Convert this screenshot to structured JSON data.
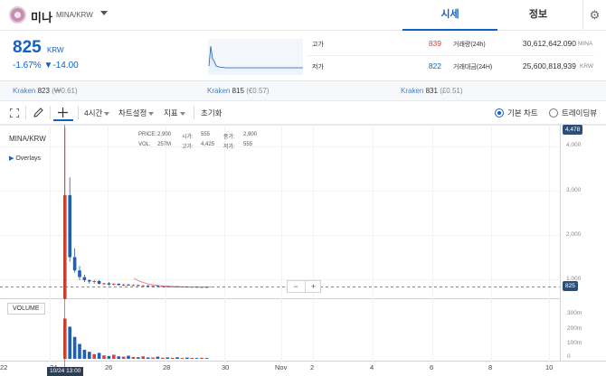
{
  "header": {
    "coin_name": "미나",
    "pair": "MINA/KRW",
    "tabs": [
      "시세",
      "정보"
    ]
  },
  "price": {
    "current": "825",
    "unit": "KRW",
    "change": "-1.67% ▼-14.00",
    "high_label": "고가",
    "high": "839",
    "low_label": "저가",
    "low": "822",
    "volume_label": "거래량(24h)",
    "volume": "30,612,642.090",
    "volume_unit": "MINA",
    "amount_label": "거래대금(24H)",
    "amount": "25,600,818,939",
    "amount_unit": "KRW"
  },
  "exchanges": [
    {
      "name": "Kraken",
      "price": "823",
      "diff": "(₩0.61)"
    },
    {
      "name": "Kraken",
      "price": "815",
      "diff": "(€0.57)"
    },
    {
      "name": "Kraken",
      "price": "831",
      "diff": "(£0.51)"
    }
  ],
  "toolbar": {
    "interval": "4시간",
    "chart_settings": "차트설정",
    "indicators": "지표",
    "reset": "초기화",
    "basic_chart": "기본 차트",
    "tradingview": "트레이딩뷰"
  },
  "chart": {
    "pair": "MINA/KRW",
    "overlays": "Overlays",
    "ohlc": {
      "price_label": "PRICE:",
      "price": "2,900",
      "open_label": "시가:",
      "open": "555",
      "close_label": "종가:",
      "close": "2,900",
      "vol_label": "VOL:",
      "vol": "257M",
      "high_label": "고가:",
      "high": "4,425",
      "low_label": "저가:",
      "low": "555"
    },
    "volume_label": "VOLUME",
    "last_price_tag": "825",
    "top_tag": "4,478",
    "cursor_time": "10/24 13:00",
    "zoom_out": "−",
    "zoom_in": "+"
  },
  "chart_data": {
    "type": "candlestick",
    "y_ticks": [
      "4,000",
      "3,000",
      "2,000",
      "1,000"
    ],
    "volume_ticks": [
      "300m",
      "200m",
      "100m",
      "0"
    ],
    "x_ticks": [
      "22",
      "24",
      "26",
      "28",
      "30",
      "Nov",
      "2",
      "4",
      "6",
      "8",
      "10"
    ],
    "candles": [
      {
        "o": 555,
        "h": 4425,
        "l": 555,
        "c": 2900,
        "dir": "up"
      },
      {
        "o": 2900,
        "h": 3300,
        "l": 1400,
        "c": 1500,
        "dir": "down"
      },
      {
        "o": 1500,
        "h": 1700,
        "l": 1150,
        "c": 1200,
        "dir": "down"
      },
      {
        "o": 1200,
        "h": 1300,
        "l": 980,
        "c": 1050,
        "dir": "down"
      },
      {
        "o": 1050,
        "h": 1100,
        "l": 940,
        "c": 980,
        "dir": "down"
      },
      {
        "o": 980,
        "h": 1000,
        "l": 900,
        "c": 950,
        "dir": "down"
      },
      {
        "o": 950,
        "h": 990,
        "l": 900,
        "c": 960,
        "dir": "up"
      },
      {
        "o": 960,
        "h": 980,
        "l": 880,
        "c": 900,
        "dir": "down"
      },
      {
        "o": 900,
        "h": 920,
        "l": 870,
        "c": 910,
        "dir": "up"
      },
      {
        "o": 910,
        "h": 940,
        "l": 860,
        "c": 880,
        "dir": "down"
      },
      {
        "o": 880,
        "h": 910,
        "l": 860,
        "c": 900,
        "dir": "up"
      },
      {
        "o": 900,
        "h": 910,
        "l": 860,
        "c": 870,
        "dir": "down"
      },
      {
        "o": 870,
        "h": 900,
        "l": 850,
        "c": 880,
        "dir": "up"
      },
      {
        "o": 880,
        "h": 900,
        "l": 860,
        "c": 865,
        "dir": "down"
      },
      {
        "o": 865,
        "h": 890,
        "l": 850,
        "c": 870,
        "dir": "up"
      },
      {
        "o": 870,
        "h": 880,
        "l": 845,
        "c": 855,
        "dir": "down"
      },
      {
        "o": 855,
        "h": 870,
        "l": 845,
        "c": 860,
        "dir": "up"
      },
      {
        "o": 860,
        "h": 870,
        "l": 840,
        "c": 848,
        "dir": "down"
      },
      {
        "o": 848,
        "h": 860,
        "l": 838,
        "c": 852,
        "dir": "up"
      },
      {
        "o": 852,
        "h": 858,
        "l": 835,
        "c": 842,
        "dir": "down"
      },
      {
        "o": 842,
        "h": 850,
        "l": 832,
        "c": 845,
        "dir": "up"
      },
      {
        "o": 845,
        "h": 850,
        "l": 830,
        "c": 838,
        "dir": "down"
      },
      {
        "o": 838,
        "h": 845,
        "l": 828,
        "c": 841,
        "dir": "up"
      },
      {
        "o": 841,
        "h": 845,
        "l": 828,
        "c": 833,
        "dir": "down"
      },
      {
        "o": 833,
        "h": 842,
        "l": 826,
        "c": 836,
        "dir": "up"
      },
      {
        "o": 836,
        "h": 840,
        "l": 824,
        "c": 829,
        "dir": "down"
      },
      {
        "o": 829,
        "h": 836,
        "l": 823,
        "c": 832,
        "dir": "up"
      },
      {
        "o": 832,
        "h": 836,
        "l": 822,
        "c": 826,
        "dir": "down"
      },
      {
        "o": 826,
        "h": 832,
        "l": 822,
        "c": 828,
        "dir": "up"
      },
      {
        "o": 828,
        "h": 830,
        "l": 822,
        "c": 825,
        "dir": "down"
      }
    ],
    "volumes": [
      257,
      205,
      140,
      95,
      58,
      45,
      30,
      38,
      22,
      18,
      26,
      16,
      14,
      20,
      12,
      10,
      16,
      9,
      8,
      14,
      7,
      9,
      6,
      10,
      5,
      8,
      6,
      5,
      7,
      5
    ],
    "colors": {
      "up": "#c84a3a",
      "down": "#1f5fb6",
      "ma": "#e07070"
    }
  }
}
